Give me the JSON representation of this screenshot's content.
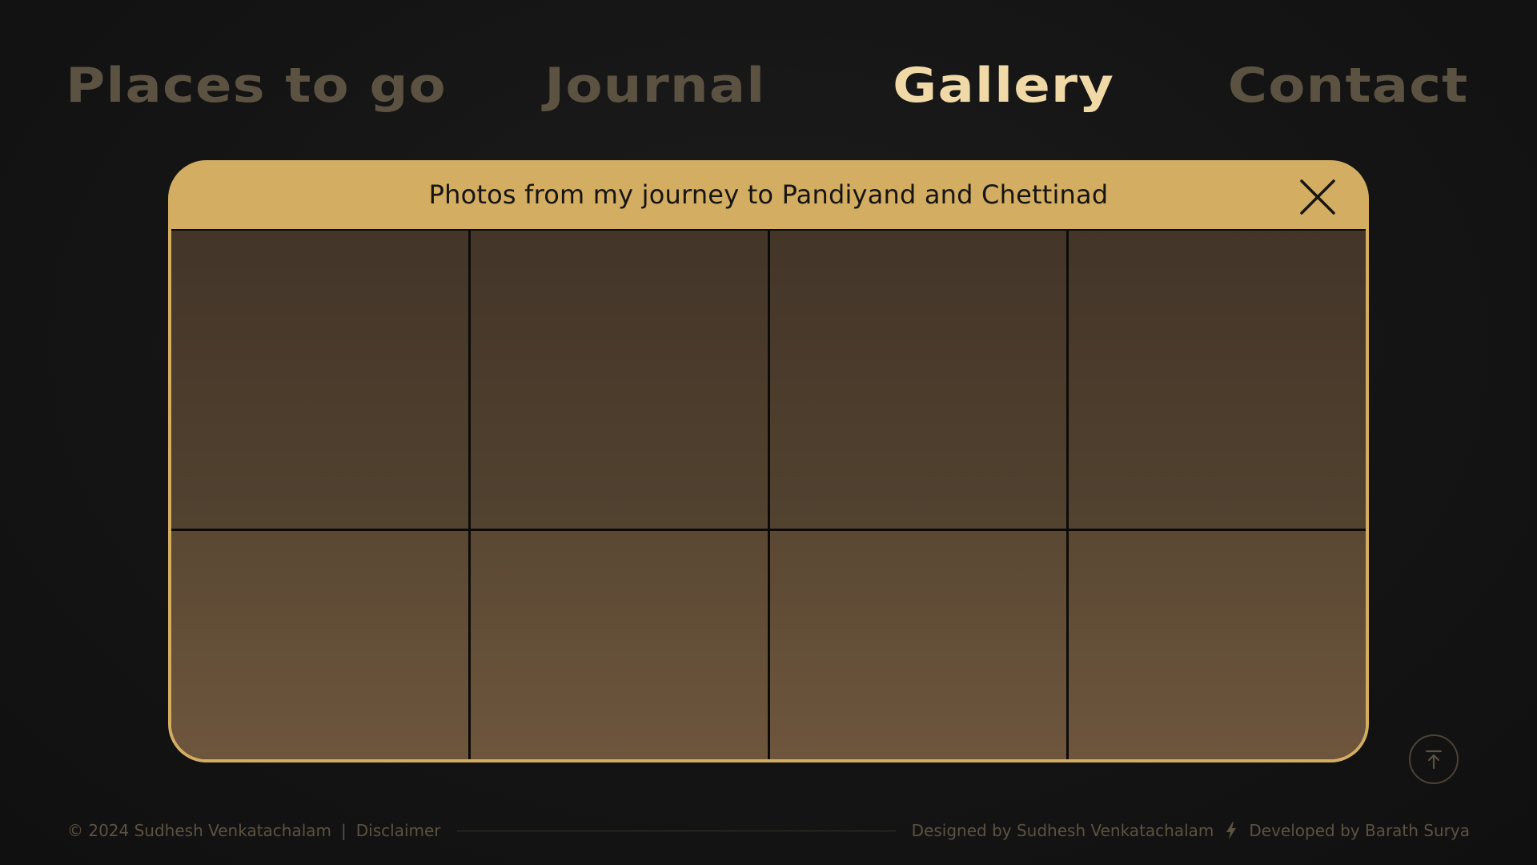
{
  "nav": {
    "items": [
      {
        "label": "Places to go",
        "active": false
      },
      {
        "label": "Journal",
        "active": false
      },
      {
        "label": "Gallery",
        "active": true
      },
      {
        "label": "Contact",
        "active": false
      }
    ]
  },
  "modal": {
    "title": "Photos from my journey to Pandiyand and Chettinad",
    "close_icon": "close-icon",
    "photo_count": 8
  },
  "footer": {
    "copyright": "© 2024 Sudhesh Venkatachalam",
    "separator": "|",
    "disclaimer": "Disclaimer",
    "designed_by": "Designed by Sudhesh Venkatachalam",
    "developed_by": "Developed by Barath Surya",
    "bolt_icon": "lightning-bolt-icon"
  },
  "scroll_top": {
    "icon": "arrow-up-to-top-icon"
  },
  "colors": {
    "background": "#141414",
    "nav_inactive": "#5c5242",
    "nav_active": "#f0d9a6",
    "modal_accent": "#d3ad62",
    "footer_text": "#5c5242"
  }
}
